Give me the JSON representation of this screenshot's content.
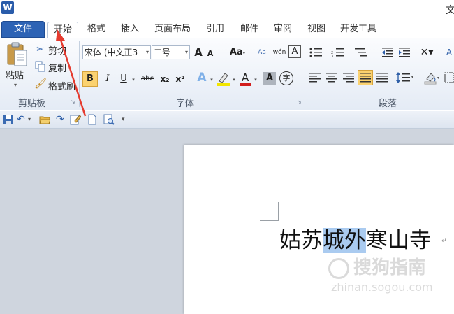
{
  "title_bar": {
    "app_icon": "W",
    "document_title": "文"
  },
  "tabs": [
    "文件",
    "开始",
    "格式",
    "插入",
    "页面布局",
    "引用",
    "邮件",
    "审阅",
    "视图",
    "开发工具"
  ],
  "ribbon": {
    "clipboard": {
      "paste": "粘贴",
      "cut": "剪切",
      "copy": "复制",
      "format_painter": "格式刷",
      "group_label": "剪贴板"
    },
    "font": {
      "font_name": "宋体 (中文正3",
      "font_size": "二号",
      "grow": "A",
      "shrink": "A",
      "change_case": "Aa",
      "phonetic": "wén",
      "char_border": "A",
      "bold": "B",
      "italic": "I",
      "underline": "U",
      "strikethrough": "abc",
      "subscript": "x₂",
      "superscript": "x²",
      "text_effect": "A",
      "highlight_color": "#f2e600",
      "font_color": "#d21e1e",
      "char_shading": "A",
      "enclose_char": "字",
      "group_label": "字体"
    },
    "paragraph": {
      "group_label": "段落"
    }
  },
  "document": {
    "before": "姑苏",
    "selected": "城外",
    "after": "寒山寺",
    "para_mark": "↵"
  },
  "watermark": {
    "brand": "搜狗指南",
    "domain": "zhinan.sogou.com"
  },
  "colors": {
    "file_tab": "#2d63b5",
    "selection": "#aacbf0",
    "annotation_arrow": "#e53b2f"
  }
}
